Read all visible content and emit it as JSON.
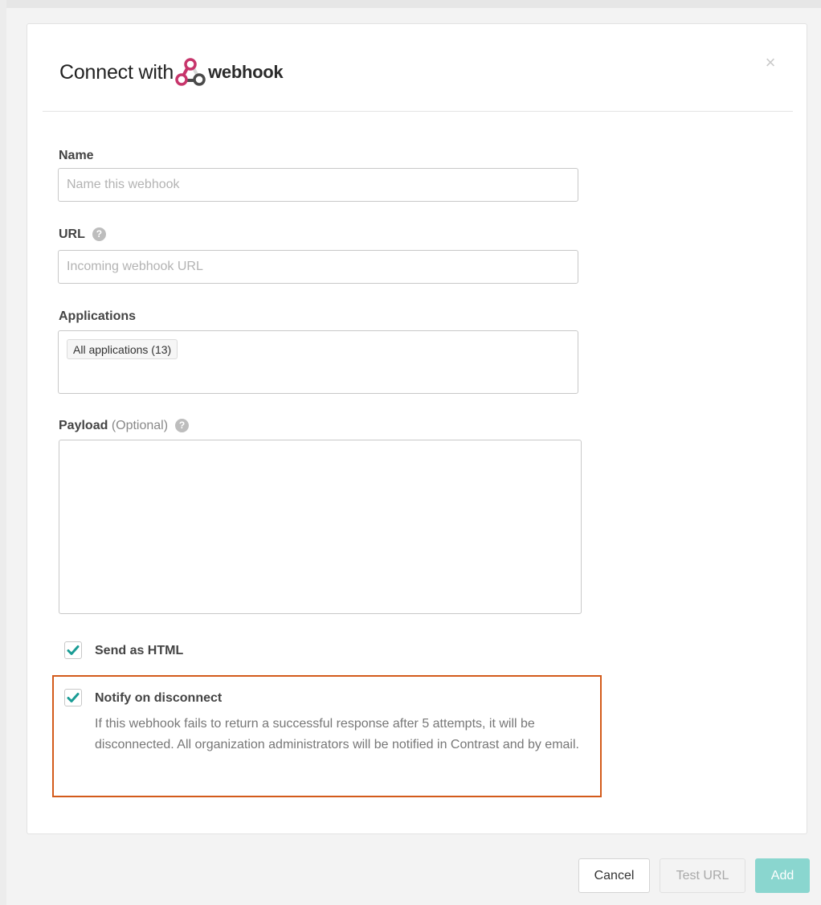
{
  "modal": {
    "title_prefix": "Connect with",
    "brand_word": "webhook",
    "logo_icon": "webhook-logo-icon",
    "close_glyph": "×"
  },
  "form": {
    "name": {
      "label": "Name",
      "placeholder": "Name this webhook",
      "value": ""
    },
    "url": {
      "label": "URL",
      "help_glyph": "?",
      "placeholder": "Incoming webhook URL",
      "value": ""
    },
    "applications": {
      "label": "Applications",
      "selected_tag": "All applications (13)"
    },
    "payload": {
      "label": "Payload",
      "label_suffix": "(Optional)",
      "help_glyph": "?",
      "value": ""
    },
    "send_as_html": {
      "label": "Send as HTML",
      "checked": true
    },
    "notify_on_disconnect": {
      "label": "Notify on disconnect",
      "checked": true,
      "description": "If this webhook fails to return a successful response after 5 attempts, it will be disconnected. All organization administrators will be notified in Contrast and by email."
    }
  },
  "buttons": {
    "cancel": "Cancel",
    "test_url": "Test URL",
    "add": "Add"
  },
  "colors": {
    "accent_teal": "#1a9c95",
    "add_button": "#8ad6cf",
    "highlight_border": "#d35b1b",
    "logo_magenta": "#c7356b"
  }
}
